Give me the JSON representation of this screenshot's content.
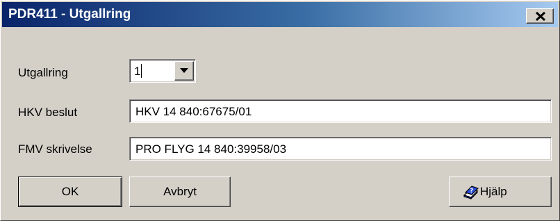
{
  "window": {
    "title": "PDR411 - Utgallring",
    "close_label": "x",
    "title_gradient": [
      "#0a246a",
      "#3a6ea5",
      "#a6caf0"
    ],
    "face_color": "#d4d0c8"
  },
  "form": {
    "utgallring_label": "Utgallring",
    "utgallring_value": "1",
    "hkv_label": "HKV beslut",
    "hkv_value": "HKV 14 840:67675/01",
    "fmv_label": "FMV skrivelse",
    "fmv_value": "PRO FLYG 14 840:39958/03"
  },
  "buttons": {
    "ok_label": "OK",
    "cancel_label": "Avbryt",
    "help_label": "Hjälp",
    "help_icon": "help-book-icon"
  }
}
